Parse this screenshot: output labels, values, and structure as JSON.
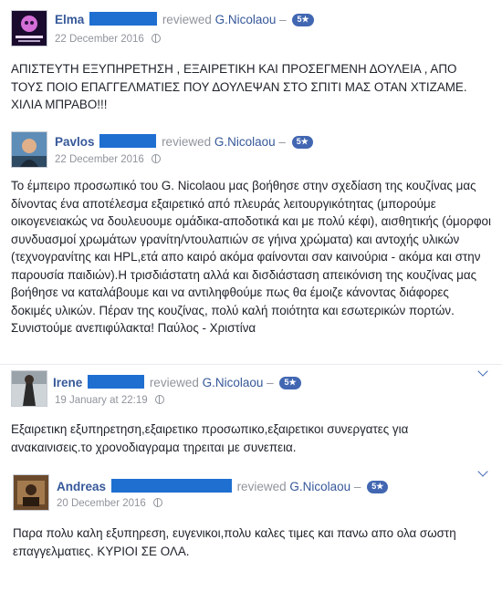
{
  "reviews": [
    {
      "name": "Elma",
      "action": "reviewed",
      "page": "G.Nicolaou",
      "separator": "–",
      "rating": "5★",
      "date": "22 December 2016",
      "privacy_icon": "globe-icon",
      "text": "ΑΠΙΣΤΕΥΤΗ ΕΞΥΠΗΡΕΤΗΣΗ , ΕΞΑΙΡΕΤΙΚΗ ΚΑΙ ΠΡΟΣΕΓΜΕΝΗ ΔΟΥΛΕΙΑ , ΑΠΟ ΤΟΥΣ ΠΟΙΟ ΕΠΑΓΓΕΛΜΑΤΙΕΣ ΠΟΥ ΔΟΥΛΕΨΑΝ ΣΤΟ ΣΠΙΤΙ ΜΑΣ ΟΤΑΝ ΧΤΙΖΑΜΕ. ΧΙΛΙΑ ΜΠΡΑΒΟ!!!"
    },
    {
      "name": "Pavlos",
      "action": "reviewed",
      "page": "G.Nicolaou",
      "separator": "–",
      "rating": "5★",
      "date": "22 December 2016",
      "privacy_icon": "globe-icon",
      "text": "Το έμπειρο προσωπικό του G. Nicolaou μας βοήθησε στην σχεδίαση της κουζίνας μας δίνοντας ένα αποτέλεσμα εξαιρετικό από πλευράς λειτουργικότητας (μπορούμε οικογενειακώς να δουλευουμε ομάδικα-αποδοτικά και με πολύ κέφι), αισθητικής (όμορφοι συνδυασμοί χρωμάτων γρανίτη/ντουλαπιών σε γήινα χρώματα) και αντοχής υλικών (τεχνογρανίτης και HPL,ετά απο καιρό ακόμα φαίνονται σαν καινούρια - ακόμα και στην παρουσία παιδιών).Η τρισδιάστατη αλλά και δισδιάσταση απεικόνιση της κουζίνας μας βοήθησε να καταλάβουμε και να αντιληφθούμε πως θα έμοιζε κάνοντας διάφορες δοκιμές υλικών. Πέραν της κουζίνας, πολύ καλή ποιότητα και εσωτερικών πορτών. Συνιστούμε ανεπιφύλακτα! Παύλος - Χριστίνα"
    },
    {
      "name": "Irene",
      "action": "reviewed",
      "page": "G.Nicolaou",
      "separator": "–",
      "rating": "5★",
      "date": "19 January at 22:19",
      "privacy_icon": "globe-icon",
      "text": "Εξαιρετικη εξυπηρετηση,εξαιρετικο προσωπικο,εξαιρετικοι συνεργατες για ανακαινισεις.το χρονοδιαγραμα τηρειται με συνεπεια."
    },
    {
      "name": "Andreas",
      "action": "reviewed",
      "page": "G.Nicolaou",
      "separator": "–",
      "rating": "5★",
      "date": "20 December 2016",
      "privacy_icon": "globe-icon",
      "text": "Παρα πολυ καλη εξυπηρεση, ευγενικοι,πολυ καλες τιμες και πανω απο ολα σωστη επαγγελματιες. ΚΥΡΙΟΙ ΣΕ ΟΛΑ."
    }
  ],
  "colors": {
    "name_link": "#365899",
    "redaction": "#1f6fd1",
    "rating_badge": "#4267b2",
    "meta_text": "#90949c"
  }
}
